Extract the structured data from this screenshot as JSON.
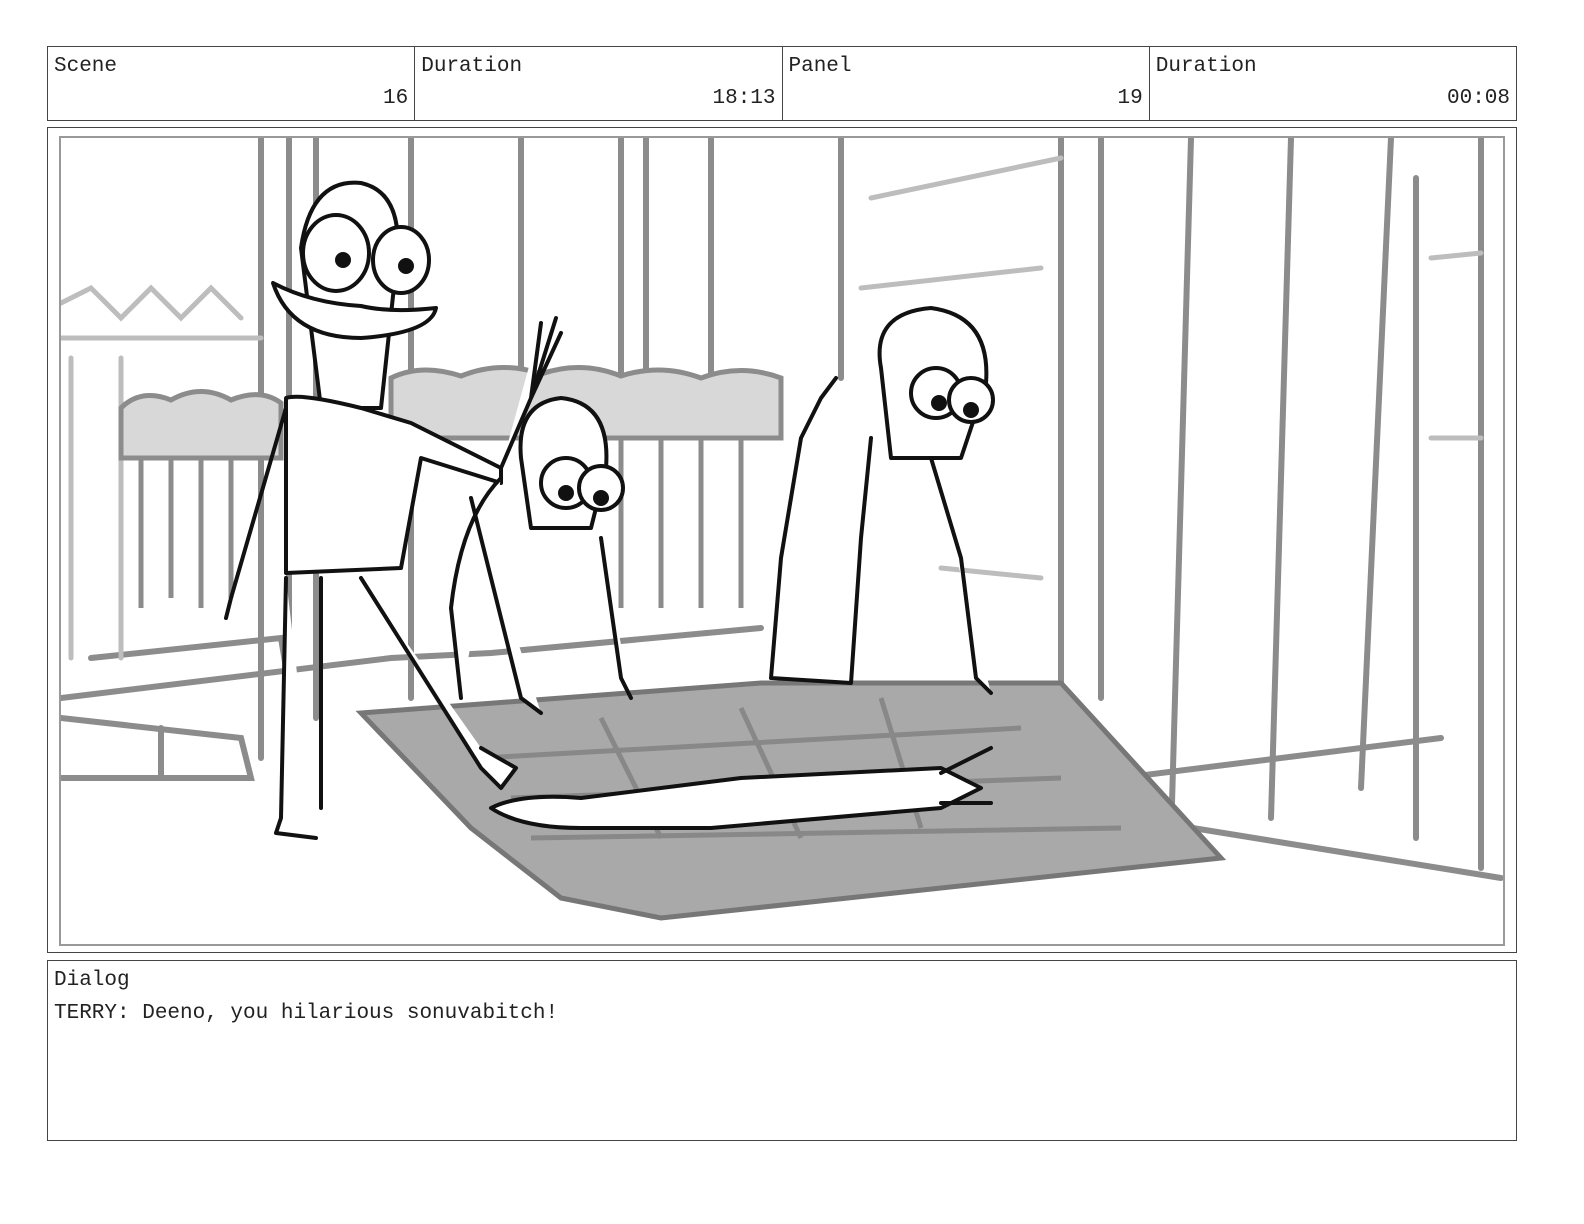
{
  "header": {
    "scene": {
      "label": "Scene",
      "value": "16"
    },
    "scene_duration": {
      "label": "Duration",
      "value": "18:13"
    },
    "panel": {
      "label": "Panel",
      "value": "19"
    },
    "panel_duration": {
      "label": "Duration",
      "value": "00:08"
    }
  },
  "artwork": {
    "description_icon": "storyboard-sketch-icon",
    "colors": {
      "ink": "#111111",
      "bg_lines": "#8c8c8c",
      "light_lines": "#bdbdbd",
      "door_fill": "#a9a9a9"
    }
  },
  "dialog": {
    "label": "Dialog",
    "text": "TERRY: Deeno, you hilarious sonuvabitch!"
  }
}
